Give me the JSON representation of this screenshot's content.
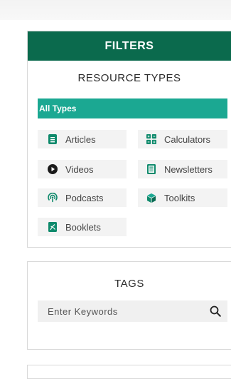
{
  "filters": {
    "header": "FILTERS",
    "resource_types": {
      "title": "RESOURCE TYPES",
      "all_label": "All Types",
      "items": [
        {
          "label": "Articles",
          "icon": "article-icon"
        },
        {
          "label": "Calculators",
          "icon": "calculator-icon"
        },
        {
          "label": "Videos",
          "icon": "video-play-icon"
        },
        {
          "label": "Newsletters",
          "icon": "newsletter-icon"
        },
        {
          "label": "Podcasts",
          "icon": "podcast-icon"
        },
        {
          "label": "Toolkits",
          "icon": "toolkit-box-icon"
        },
        {
          "label": "Booklets",
          "icon": "booklet-pdf-icon"
        }
      ]
    }
  },
  "tags": {
    "title": "TAGS",
    "search": {
      "placeholder": "Enter Keywords",
      "value": ""
    }
  },
  "colors": {
    "header_bg": "#0b6a4d",
    "selected_bg": "#1ba892",
    "item_bg": "#f3f3f3",
    "icon_color": "#0f8a6c"
  }
}
